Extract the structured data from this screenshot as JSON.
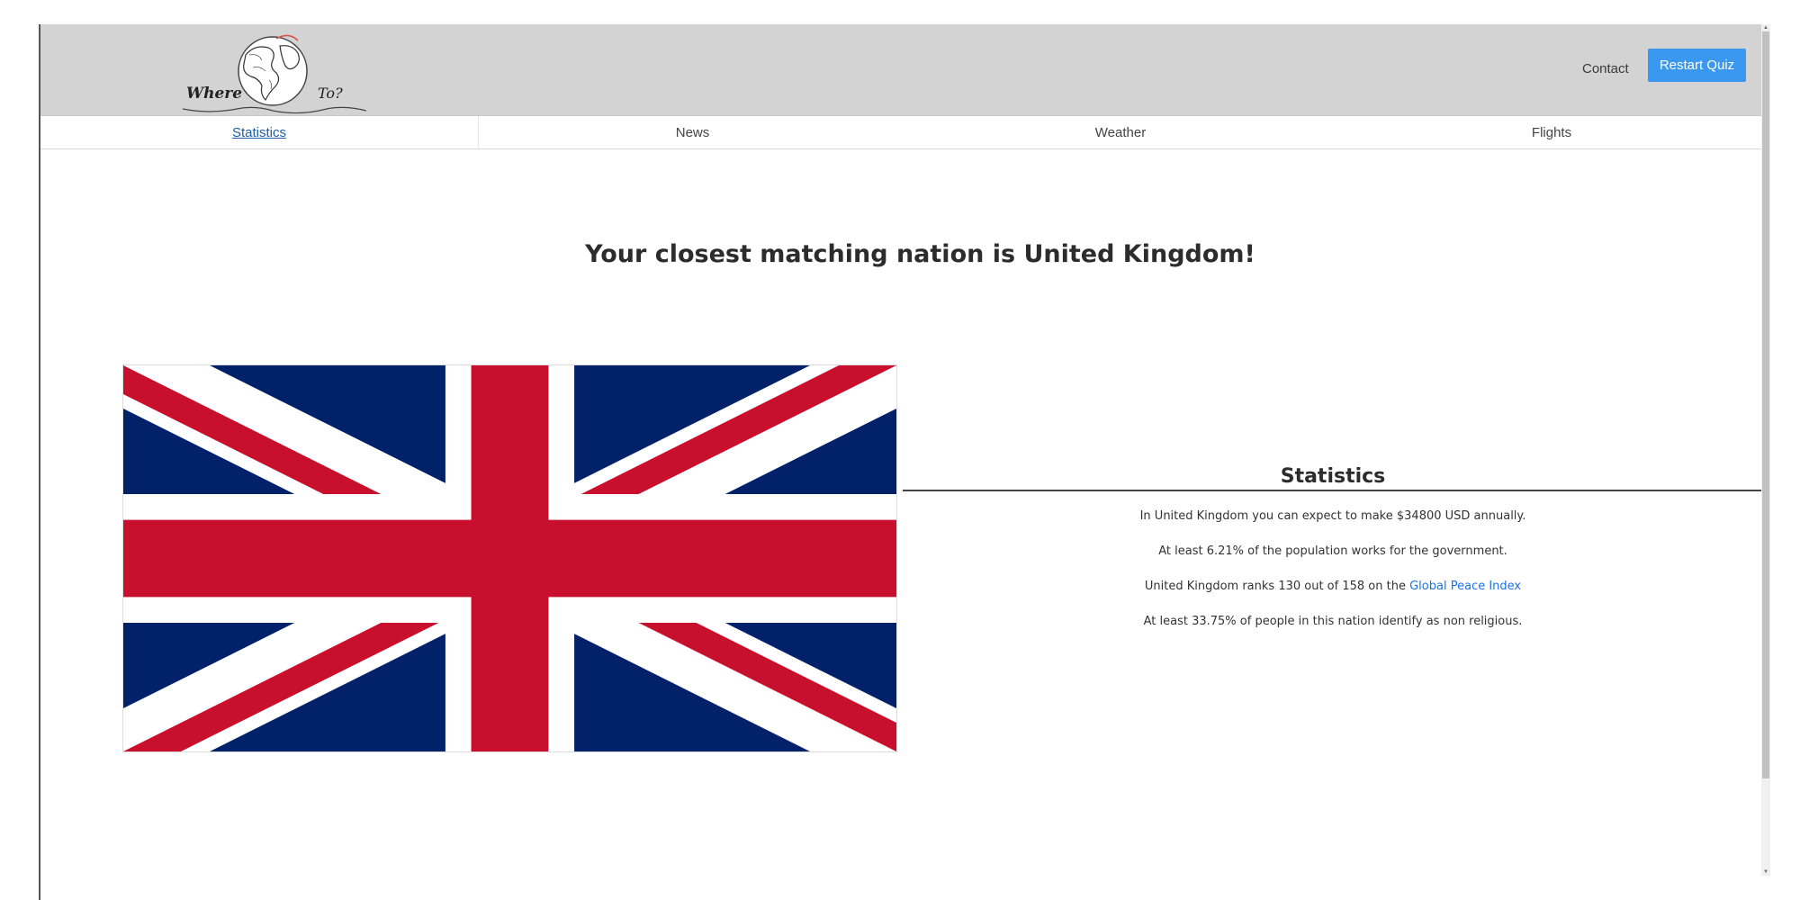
{
  "header": {
    "logo_word_left": "Where",
    "logo_word_right": "To?",
    "contact_label": "Contact",
    "restart_label": "Restart Quiz",
    "background_color": "#d3d3d3",
    "accent_color": "#3b98f0"
  },
  "tabs": [
    {
      "label": "Statistics",
      "active": true
    },
    {
      "label": "News",
      "active": false
    },
    {
      "label": "Weather",
      "active": false
    },
    {
      "label": "Flights",
      "active": false
    }
  ],
  "result": {
    "title": "Your closest matching nation is United Kingdom!"
  },
  "flag": {
    "icon": "union-jack-flag",
    "colors": {
      "blue": "#012169",
      "red": "#c8102e",
      "white": "#ffffff"
    }
  },
  "statistics": {
    "heading": "Statistics",
    "income_line": "In United Kingdom you can expect to make $34800 USD annually.",
    "government_line": "At least 6.21% of the population works for the government.",
    "peace_line_prefix": "United Kingdom ranks 130 out of 158 on the",
    "peace_link_label": "Global Peace Index",
    "religion_line": "At least 33.75% of people in this nation identify as non religious."
  }
}
